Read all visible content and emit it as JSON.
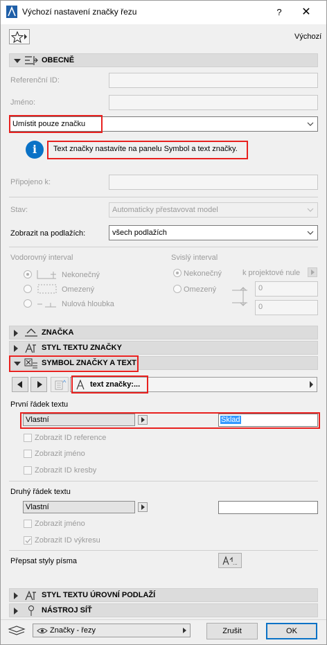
{
  "window": {
    "title": "Výchozí nastavení značky řezu",
    "help": "?",
    "close": "✕"
  },
  "toolbar": {
    "favorites_icon": "star-icon",
    "defaults_label": "Výchozí"
  },
  "general": {
    "header": "OBECNĚ",
    "ref_id_label": "Referenční ID:",
    "ref_id_value": "",
    "name_label": "Jméno:",
    "name_value": "",
    "placement_value": "Umístit pouze značku",
    "info_text": "Text značky nastavíte na panelu Symbol a text značky.",
    "attached_label": "Připojeno k:",
    "attached_value": "",
    "status_label": "Stav:",
    "status_value": "Automaticky přestavovat model",
    "show_on_label": "Zobrazit na podlažích:",
    "show_on_value": "všech podlažích",
    "h_interval_label": "Vodorovný interval",
    "h_opt_infinite": "Nekonečný",
    "h_opt_limited": "Omezený",
    "h_opt_zero": "Nulová hloubka",
    "v_interval_label": "Svislý interval",
    "v_opt_infinite": "Nekonečný",
    "v_opt_limited": "Omezený",
    "v_reference": "k projektové nule",
    "v_top_value": "0",
    "v_bottom_value": "0"
  },
  "sections": {
    "marker": "ZNAČKA",
    "marker_text_style": "STYL TEXTU ZNAČKY",
    "symbol_and_text": "SYMBOL ZNAČKY A TEXT",
    "level_text_style": "STYL TEXTU ÚROVNÍ PODLAŽÍ",
    "grid_tool": "NÁSTROJ SÍŤ"
  },
  "symbol": {
    "page_selector": "text značky:...",
    "first_line_label": "První řádek textu",
    "first_line_type": "Vlastní",
    "first_line_value": "Sklad",
    "opt_show_ref_id": "Zobrazit ID reference",
    "opt_show_name": "Zobrazit jméno",
    "opt_show_drawing_id": "Zobrazit ID kresby",
    "second_line_label": "Druhý řádek textu",
    "second_line_type": "Vlastní",
    "second_line_value": "",
    "opt2_show_name": "Zobrazit jméno",
    "opt2_show_sheet_id": "Zobrazit ID výkresu",
    "override_fonts_label": "Přepsat styly písma"
  },
  "footer": {
    "layer_value": "Značky - řezy",
    "cancel_label": "Zrušit",
    "ok_label": "OK"
  },
  "colors": {
    "highlight": "#e8201e",
    "accent": "#0a72c6",
    "selection": "#3399ff"
  }
}
